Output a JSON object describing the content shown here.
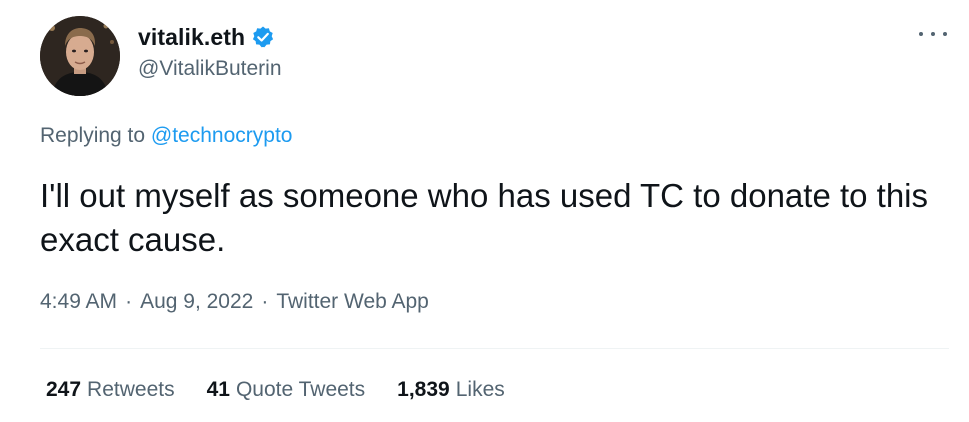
{
  "author": {
    "display_name": "vitalik.eth",
    "handle": "@VitalikButerin",
    "verified": true,
    "avatar_icon": "profile-photo"
  },
  "more_icon": "more-options-icon",
  "reply": {
    "prefix": "Replying to ",
    "mention": "@technocrypto"
  },
  "tweet": {
    "text": "I'll out myself as someone who has used TC to donate to this exact cause."
  },
  "meta": {
    "time": "4:49 AM",
    "separator": "·",
    "date": "Aug 9, 2022",
    "source": "Twitter Web App"
  },
  "stats": {
    "retweets_count": "247",
    "retweets_label": "Retweets",
    "quote_count": "41",
    "quote_label": "Quote Tweets",
    "likes_count": "1,839",
    "likes_label": "Likes"
  },
  "colors": {
    "accent": "#1d9bf0",
    "text": "#0f1419",
    "secondary": "#536471",
    "divider": "#eff3f4"
  }
}
